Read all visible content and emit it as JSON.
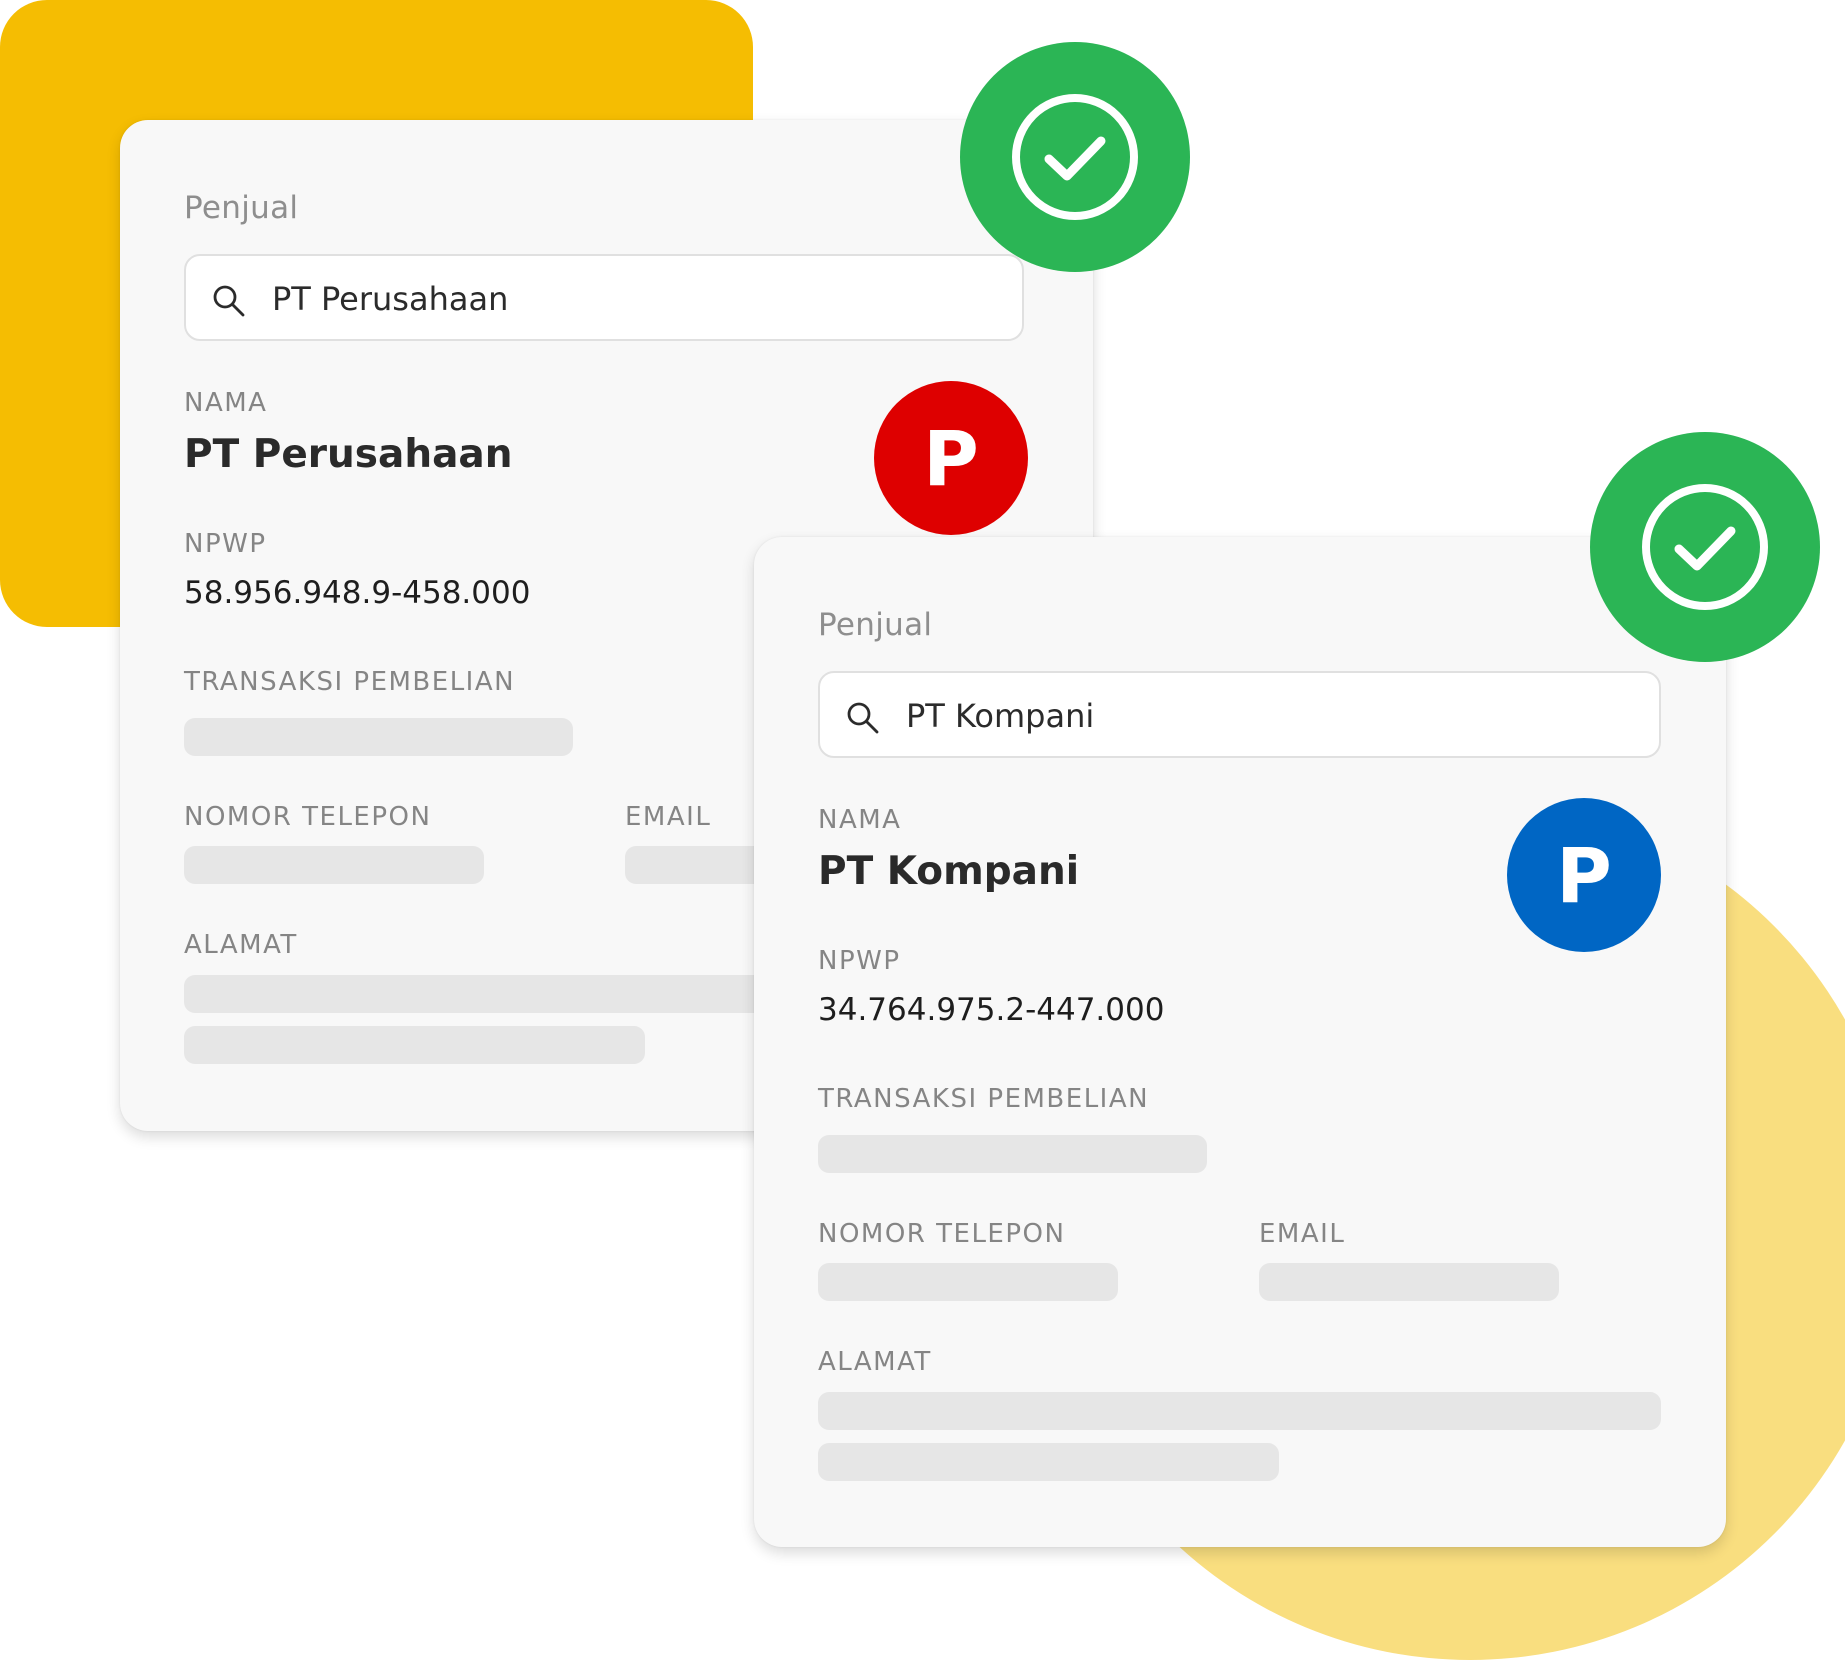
{
  "colors": {
    "accent_yellow": "#F5BD02",
    "light_yellow": "#F9DE7F",
    "success_green": "#2BB555",
    "avatar_red": "#DE0000",
    "avatar_blue": "#0066C4"
  },
  "cards": [
    {
      "section_label": "Penjual",
      "search": {
        "icon": "search-icon",
        "value": "PT Perusahaan"
      },
      "nama_label": "NAMA",
      "nama_value": "PT Perusahaan",
      "avatar_letter": "P",
      "npwp_label": "NPWP",
      "npwp_value": "58.956.948.9-458.000",
      "transaksi_label": "TRANSAKSI PEMBELIAN",
      "telepon_label": "NOMOR TELEPON",
      "email_label": "EMAIL",
      "alamat_label": "ALAMAT",
      "status_icon": "check-circle-icon"
    },
    {
      "section_label": "Penjual",
      "search": {
        "icon": "search-icon",
        "value": "PT Kompani"
      },
      "nama_label": "NAMA",
      "nama_value": "PT Kompani",
      "avatar_letter": "P",
      "npwp_label": "NPWP",
      "npwp_value": "34.764.975.2-447.000",
      "transaksi_label": "TRANSAKSI PEMBELIAN",
      "telepon_label": "NOMOR TELEPON",
      "email_label": "EMAIL",
      "alamat_label": "ALAMAT",
      "status_icon": "check-circle-icon"
    }
  ]
}
